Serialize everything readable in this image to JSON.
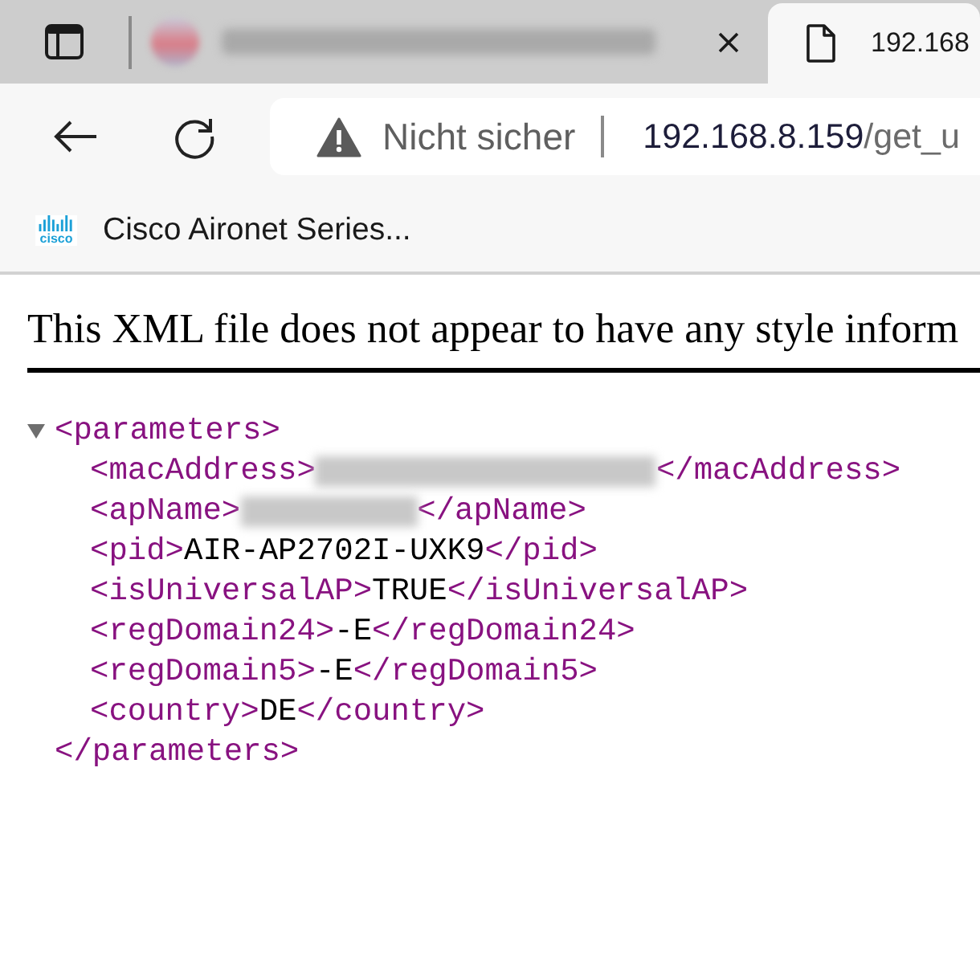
{
  "tabs": [
    {
      "redacted": true,
      "selected": false
    },
    {
      "title": "192.168",
      "redacted": false,
      "selected": true
    }
  ],
  "address_bar": {
    "security_label": "Nicht sicher",
    "host": "192.168.8.159",
    "path": "/get_u"
  },
  "bookmarks": [
    {
      "logo_text": "cisco",
      "label": "Cisco Aironet Series..."
    }
  ],
  "page": {
    "notice": "This XML file does not appear to have any style inform",
    "root": {
      "open": "<parameters>",
      "close": "</parameters>",
      "expanded": true,
      "children": [
        {
          "kind": "redacted",
          "open": "<macAddress>",
          "close": "</macAddress>"
        },
        {
          "kind": "redacted",
          "open": "<apName>",
          "close": "</apName>"
        },
        {
          "kind": "text",
          "open": "<pid>",
          "value": "AIR-AP2702I-UXK9",
          "close": "</pid>"
        },
        {
          "kind": "text",
          "open": "<isUniversalAP>",
          "value": "TRUE",
          "close": "</isUniversalAP>"
        },
        {
          "kind": "text",
          "open": "<regDomain24>",
          "value": "-E",
          "close": "</regDomain24>"
        },
        {
          "kind": "text",
          "open": "<regDomain5>",
          "value": "-E",
          "close": "</regDomain5>"
        },
        {
          "kind": "text",
          "open": "<country>",
          "value": "DE",
          "close": "</country>"
        }
      ]
    }
  }
}
